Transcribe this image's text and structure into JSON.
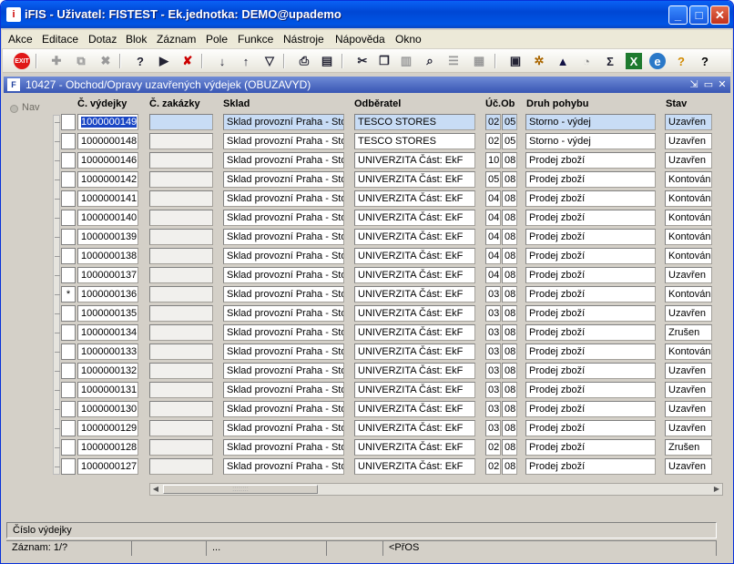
{
  "window": {
    "title": "iFIS - Uživatel: FISTEST - Ek.jednotka: DEMO@upademo",
    "app_icon": "ifis-app-icon"
  },
  "menu": [
    "Akce",
    "Editace",
    "Dotaz",
    "Blok",
    "Záznam",
    "Pole",
    "Funkce",
    "Nástroje",
    "Nápověda",
    "Okno"
  ],
  "toolbar": {
    "exit_label": "EXIT",
    "icons": [
      "exit-icon",
      "insert-record-icon",
      "duplicate-record-icon",
      "delete-record-icon",
      "enter-query-icon",
      "execute-query-icon",
      "cancel-query-icon",
      "sort-asc-icon",
      "sort-desc-icon",
      "filter-icon",
      "print-icon",
      "print-preview-icon",
      "cut-icon",
      "copy-icon",
      "paste-icon",
      "find-icon",
      "list-icon",
      "columns-icon",
      "calculator-icon",
      "settings-icon",
      "chart-icon",
      "clock-icon",
      "sum-icon",
      "excel-icon",
      "web-icon",
      "help-icon",
      "context-help-icon"
    ]
  },
  "form": {
    "title": "10427 - Obchod/Opravy uzavřených výdejek (OBUZAVYD)",
    "nav_label": "Nav",
    "columns": {
      "cislo": "Č. výdejky",
      "zakazka": "Č. zakázky",
      "sklad": "Sklad",
      "odberatel": "Odběratel",
      "ucob": "Úč.Ob",
      "druh": "Druh pohybu",
      "stav": "Stav"
    },
    "rows": [
      {
        "cislo": "1000000149",
        "zakazka": "",
        "sklad": "Sklad provozní Praha - Sto",
        "odberatel": "TESCO STORES",
        "uc": "02",
        "ob": "05",
        "druh": "Storno - výdej",
        "stav": "Uzavřen",
        "marker": ""
      },
      {
        "cislo": "1000000148",
        "zakazka": "",
        "sklad": "Sklad provozní Praha - Sto",
        "odberatel": "TESCO STORES",
        "uc": "02",
        "ob": "05",
        "druh": "Storno - výdej",
        "stav": "Uzavřen",
        "marker": ""
      },
      {
        "cislo": "1000000146",
        "zakazka": "",
        "sklad": "Sklad provozní Praha - Sto",
        "odberatel": "UNIVERZITA Část: EkF",
        "uc": "10",
        "ob": "08",
        "druh": "Prodej zboží",
        "stav": "Uzavřen",
        "marker": ""
      },
      {
        "cislo": "1000000142",
        "zakazka": "",
        "sklad": "Sklad provozní Praha - Sto",
        "odberatel": "UNIVERZITA Část: EkF",
        "uc": "05",
        "ob": "08",
        "druh": "Prodej zboží",
        "stav": "Kontován",
        "marker": ""
      },
      {
        "cislo": "1000000141",
        "zakazka": "",
        "sklad": "Sklad provozní Praha - Sto",
        "odberatel": "UNIVERZITA Část: EkF",
        "uc": "04",
        "ob": "08",
        "druh": "Prodej zboží",
        "stav": "Kontován",
        "marker": ""
      },
      {
        "cislo": "1000000140",
        "zakazka": "",
        "sklad": "Sklad provozní Praha - Sto",
        "odberatel": "UNIVERZITA Část: EkF",
        "uc": "04",
        "ob": "08",
        "druh": "Prodej zboží",
        "stav": "Kontován",
        "marker": ""
      },
      {
        "cislo": "1000000139",
        "zakazka": "",
        "sklad": "Sklad provozní Praha - Sto",
        "odberatel": "UNIVERZITA Část: EkF",
        "uc": "04",
        "ob": "08",
        "druh": "Prodej zboží",
        "stav": "Kontován",
        "marker": ""
      },
      {
        "cislo": "1000000138",
        "zakazka": "",
        "sklad": "Sklad provozní Praha - Sto",
        "odberatel": "UNIVERZITA Část: EkF",
        "uc": "04",
        "ob": "08",
        "druh": "Prodej zboží",
        "stav": "Kontován",
        "marker": ""
      },
      {
        "cislo": "1000000137",
        "zakazka": "",
        "sklad": "Sklad provozní Praha - Sto",
        "odberatel": "UNIVERZITA Část: EkF",
        "uc": "04",
        "ob": "08",
        "druh": "Prodej zboží",
        "stav": "Uzavřen",
        "marker": ""
      },
      {
        "cislo": "1000000136",
        "zakazka": "",
        "sklad": "Sklad provozní Praha - Sto",
        "odberatel": "UNIVERZITA Část: EkF",
        "uc": "03",
        "ob": "08",
        "druh": "Prodej zboží",
        "stav": "Kontován",
        "marker": "*"
      },
      {
        "cislo": "1000000135",
        "zakazka": "",
        "sklad": "Sklad provozní Praha - Sto",
        "odberatel": "UNIVERZITA Část: EkF",
        "uc": "03",
        "ob": "08",
        "druh": "Prodej zboží",
        "stav": "Uzavřen",
        "marker": ""
      },
      {
        "cislo": "1000000134",
        "zakazka": "",
        "sklad": "Sklad provozní Praha - Sto",
        "odberatel": "UNIVERZITA Část: EkF",
        "uc": "03",
        "ob": "08",
        "druh": "Prodej zboží",
        "stav": "Zrušen",
        "marker": ""
      },
      {
        "cislo": "1000000133",
        "zakazka": "",
        "sklad": "Sklad provozní Praha - Sto",
        "odberatel": "UNIVERZITA Část: EkF",
        "uc": "03",
        "ob": "08",
        "druh": "Prodej zboží",
        "stav": "Kontován",
        "marker": ""
      },
      {
        "cislo": "1000000132",
        "zakazka": "",
        "sklad": "Sklad provozní Praha - Sto",
        "odberatel": "UNIVERZITA Část: EkF",
        "uc": "03",
        "ob": "08",
        "druh": "Prodej zboží",
        "stav": "Uzavřen",
        "marker": ""
      },
      {
        "cislo": "1000000131",
        "zakazka": "",
        "sklad": "Sklad provozní Praha - Sto",
        "odberatel": "UNIVERZITA Část: EkF",
        "uc": "03",
        "ob": "08",
        "druh": "Prodej zboží",
        "stav": "Uzavřen",
        "marker": ""
      },
      {
        "cislo": "1000000130",
        "zakazka": "",
        "sklad": "Sklad provozní Praha - Sto",
        "odberatel": "UNIVERZITA Část: EkF",
        "uc": "03",
        "ob": "08",
        "druh": "Prodej zboží",
        "stav": "Uzavřen",
        "marker": ""
      },
      {
        "cislo": "1000000129",
        "zakazka": "",
        "sklad": "Sklad provozní Praha - Sto",
        "odberatel": "UNIVERZITA Část: EkF",
        "uc": "03",
        "ob": "08",
        "druh": "Prodej zboží",
        "stav": "Uzavřen",
        "marker": ""
      },
      {
        "cislo": "1000000128",
        "zakazka": "",
        "sklad": "Sklad provozní Praha - Sto",
        "odberatel": "UNIVERZITA Část: EkF",
        "uc": "02",
        "ob": "08",
        "druh": "Prodej zboží",
        "stav": "Zrušen",
        "marker": ""
      },
      {
        "cislo": "1000000127",
        "zakazka": "",
        "sklad": "Sklad provozní Praha - Sto",
        "odberatel": "UNIVERZITA Část: EkF",
        "uc": "02",
        "ob": "08",
        "druh": "Prodej zboží",
        "stav": "Uzavřen",
        "marker": ""
      }
    ]
  },
  "status": {
    "hint": "Číslo výdejky",
    "record": "Záznam: 1/?",
    "ellipsis": "...",
    "mode": "<PřOS"
  },
  "colors": {
    "title_blue": "#0047d4",
    "selected_row": "#c8dcf5",
    "focus": "#1a46c4"
  }
}
